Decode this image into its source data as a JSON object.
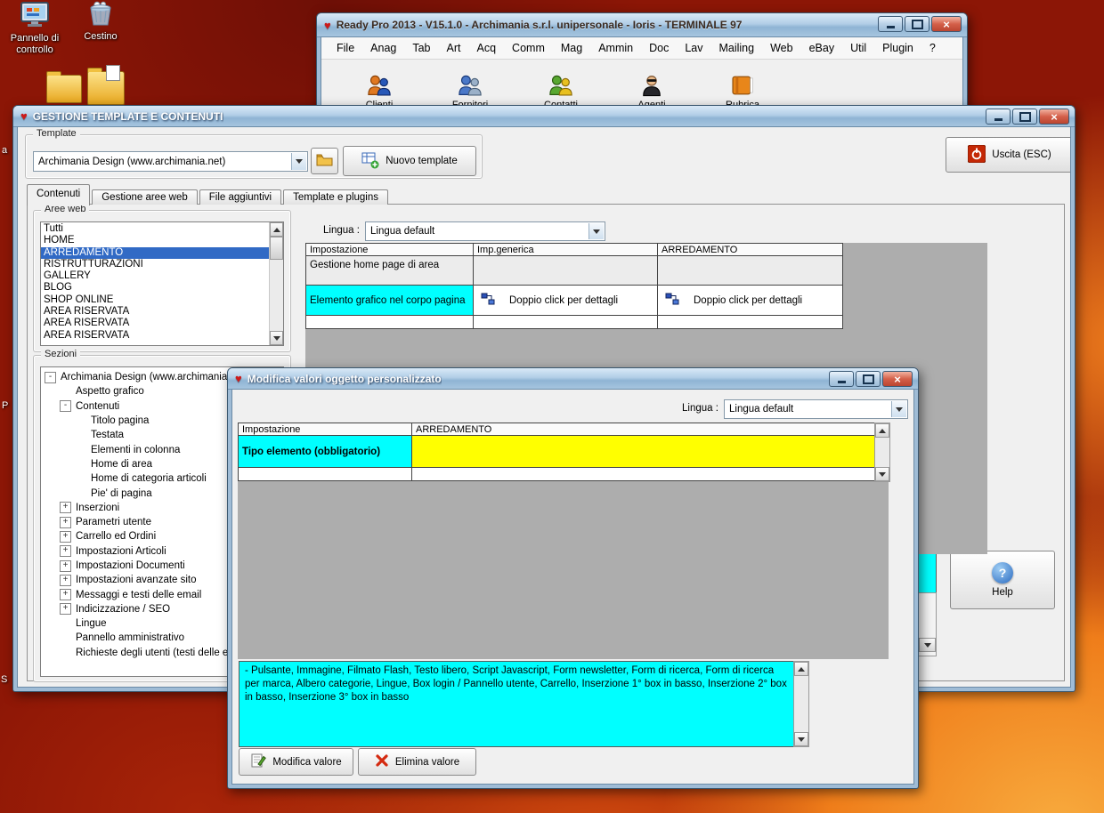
{
  "desktop": {
    "icons": [
      {
        "label": "Pannello di controllo"
      },
      {
        "label": "Cestino"
      }
    ],
    "edge_labels": [
      "a",
      "P",
      "S"
    ]
  },
  "colors": {
    "selection_blue": "#316ac5",
    "highlight_cyan": "#00ffff",
    "highlight_yellow": "#ffff00",
    "titlebar_blue": "#9fc0dd",
    "close_red": "#bb4530"
  },
  "ready_pro": {
    "title": "Ready Pro 2013 - V15.1.0 - Archimania s.r.l. unipersonale - Ioris - TERMINALE 97",
    "menu": [
      "File",
      "Anag",
      "Tab",
      "Art",
      "Acq",
      "Comm",
      "Mag",
      "Ammin",
      "Doc",
      "Lav",
      "Mailing",
      "Web",
      "eBay",
      "Util",
      "Plugin",
      "?"
    ],
    "toolbar": {
      "items": [
        "Clienti",
        "Fornitori",
        "Contatti",
        "Agenti",
        "Rubrica"
      ]
    }
  },
  "gestione": {
    "title": "GESTIONE TEMPLATE E CONTENUTI",
    "template_label": "Template",
    "template_value": "Archimania Design (www.archimania.net)",
    "nuovo_template": "Nuovo template",
    "uscita": "Uscita (ESC)",
    "tabs": [
      {
        "label": "Contenuti",
        "active": true
      },
      {
        "label": "Gestione aree web"
      },
      {
        "label": "File aggiuntivi"
      },
      {
        "label": "Template e plugins"
      }
    ],
    "aree_web_label": "Aree web",
    "aree_web": [
      {
        "label": "Tutti"
      },
      {
        "label": "HOME"
      },
      {
        "label": "ARREDAMENTO",
        "selected": true
      },
      {
        "label": "RISTRUTTURAZIONI"
      },
      {
        "label": "GALLERY"
      },
      {
        "label": "BLOG"
      },
      {
        "label": "SHOP ONLINE"
      },
      {
        "label": "AREA RISERVATA"
      },
      {
        "label": "AREA RISERVATA"
      },
      {
        "label": "AREA RISERVATA"
      }
    ],
    "sezioni_label": "Sezioni",
    "sezioni": [
      {
        "depth": 0,
        "glyph": "-",
        "label": "Archimania Design (www.archimania.ne"
      },
      {
        "depth": 1,
        "label": "Aspetto grafico"
      },
      {
        "depth": 1,
        "glyph": "-",
        "label": "Contenuti"
      },
      {
        "depth": 2,
        "label": "Titolo pagina"
      },
      {
        "depth": 2,
        "label": "Testata"
      },
      {
        "depth": 2,
        "label": "Elementi in colonna"
      },
      {
        "depth": 2,
        "label": "Home di area"
      },
      {
        "depth": 2,
        "label": "Home di categoria articoli"
      },
      {
        "depth": 2,
        "label": "Pie' di pagina"
      },
      {
        "depth": 1,
        "glyph": "+",
        "label": "Inserzioni"
      },
      {
        "depth": 1,
        "glyph": "+",
        "label": "Parametri utente"
      },
      {
        "depth": 1,
        "glyph": "+",
        "label": "Carrello ed Ordini"
      },
      {
        "depth": 1,
        "glyph": "+",
        "label": "Impostazioni Articoli"
      },
      {
        "depth": 1,
        "glyph": "+",
        "label": "Impostazioni Documenti"
      },
      {
        "depth": 1,
        "glyph": "+",
        "label": "Impostazioni avanzate sito"
      },
      {
        "depth": 1,
        "glyph": "+",
        "label": "Messaggi e testi delle email"
      },
      {
        "depth": 1,
        "glyph": "+",
        "label": "Indicizzazione / SEO"
      },
      {
        "depth": 1,
        "label": "Lingue"
      },
      {
        "depth": 1,
        "label": "Pannello amministrativo"
      },
      {
        "depth": 1,
        "label": "Richieste degli utenti (testi delle ema"
      }
    ],
    "lingua_label": "Lingua :",
    "lingua_value": "Lingua default",
    "table": {
      "headers": [
        "Impostazione",
        "Imp.generica",
        "ARREDAMENTO"
      ],
      "row1": "Gestione home page di area",
      "row2": "Elemento grafico nel corpo pagina",
      "double_click": "Doppio click per dettagli"
    },
    "help": "Help"
  },
  "modal": {
    "title": "Modifica valori oggetto personalizzato",
    "lingua_label": "Lingua :",
    "lingua_value": "Lingua default",
    "headers": [
      "Impostazione",
      "ARREDAMENTO"
    ],
    "row_label": "Tipo elemento (obbligatorio)",
    "info_text": "- Pulsante, Immagine, Filmato Flash, Testo libero, Script Javascript, Form newsletter, Form di ricerca, Form di ricerca per marca, Albero categorie, Lingue, Box login / Pannello utente, Carrello, Inserzione 1° box in basso, Inserzione 2° box in basso, Inserzione 3° box in basso",
    "modifica": "Modifica valore",
    "elimina": "Elimina valore"
  }
}
